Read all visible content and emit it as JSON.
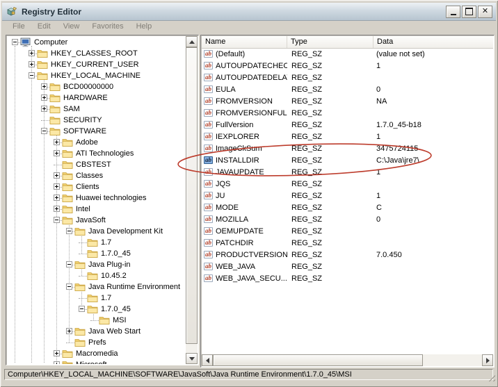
{
  "window": {
    "title": "Registry Editor",
    "app_icon": "regedit-icon",
    "controls": {
      "minimize": "minimize",
      "maximize": "maximize",
      "close": "close"
    }
  },
  "menu": {
    "items": [
      "File",
      "Edit",
      "View",
      "Favorites",
      "Help"
    ]
  },
  "tree": {
    "items": [
      {
        "label": "Computer",
        "level": 0,
        "toggle": "minus",
        "icon": "computer"
      },
      {
        "label": "HKEY_CLASSES_ROOT",
        "level": 1,
        "toggle": "plus",
        "icon": "folder"
      },
      {
        "label": "HKEY_CURRENT_USER",
        "level": 1,
        "toggle": "plus",
        "icon": "folder"
      },
      {
        "label": "HKEY_LOCAL_MACHINE",
        "level": 1,
        "toggle": "minus",
        "icon": "folder"
      },
      {
        "label": "BCD00000000",
        "level": 2,
        "toggle": "plus",
        "icon": "folder"
      },
      {
        "label": "HARDWARE",
        "level": 2,
        "toggle": "plus",
        "icon": "folder"
      },
      {
        "label": "SAM",
        "level": 2,
        "toggle": "plus",
        "icon": "folder"
      },
      {
        "label": "SECURITY",
        "level": 2,
        "toggle": "none",
        "icon": "folder"
      },
      {
        "label": "SOFTWARE",
        "level": 2,
        "toggle": "minus",
        "icon": "folder"
      },
      {
        "label": "Adobe",
        "level": 3,
        "toggle": "plus",
        "icon": "folder"
      },
      {
        "label": "ATI Technologies",
        "level": 3,
        "toggle": "plus",
        "icon": "folder"
      },
      {
        "label": "CBSTEST",
        "level": 3,
        "toggle": "none",
        "icon": "folder"
      },
      {
        "label": "Classes",
        "level": 3,
        "toggle": "plus",
        "icon": "folder"
      },
      {
        "label": "Clients",
        "level": 3,
        "toggle": "plus",
        "icon": "folder"
      },
      {
        "label": "Huawei technologies",
        "level": 3,
        "toggle": "plus",
        "icon": "folder"
      },
      {
        "label": "Intel",
        "level": 3,
        "toggle": "plus",
        "icon": "folder"
      },
      {
        "label": "JavaSoft",
        "level": 3,
        "toggle": "minus",
        "icon": "folder"
      },
      {
        "label": "Java Development Kit",
        "level": 4,
        "toggle": "minus",
        "icon": "folder"
      },
      {
        "label": "1.7",
        "level": 5,
        "toggle": "none",
        "icon": "folder"
      },
      {
        "label": "1.7.0_45",
        "level": 5,
        "toggle": "none",
        "icon": "folder"
      },
      {
        "label": "Java Plug-in",
        "level": 4,
        "toggle": "minus",
        "icon": "folder"
      },
      {
        "label": "10.45.2",
        "level": 5,
        "toggle": "none",
        "icon": "folder"
      },
      {
        "label": "Java Runtime Environment",
        "level": 4,
        "toggle": "minus",
        "icon": "folder"
      },
      {
        "label": "1.7",
        "level": 5,
        "toggle": "none",
        "icon": "folder"
      },
      {
        "label": "1.7.0_45",
        "level": 5,
        "toggle": "minus",
        "icon": "folder"
      },
      {
        "label": "MSI",
        "level": 6,
        "toggle": "none",
        "icon": "folder"
      },
      {
        "label": "Java Web Start",
        "level": 4,
        "toggle": "plus",
        "icon": "folder"
      },
      {
        "label": "Prefs",
        "level": 4,
        "toggle": "none",
        "icon": "folder"
      },
      {
        "label": "Macromedia",
        "level": 3,
        "toggle": "plus",
        "icon": "folder"
      },
      {
        "label": "Microsoft",
        "level": 3,
        "toggle": "plus",
        "icon": "folder"
      }
    ]
  },
  "list": {
    "columns": [
      "Name",
      "Type",
      "Data"
    ],
    "rows": [
      {
        "name": "(Default)",
        "type": "REG_SZ",
        "data": "(value not set)",
        "selected": false
      },
      {
        "name": "AUTOUPDATECHECK",
        "type": "REG_SZ",
        "data": "1",
        "selected": false
      },
      {
        "name": "AUTOUPDATEDELAY",
        "type": "REG_SZ",
        "data": "",
        "selected": false
      },
      {
        "name": "EULA",
        "type": "REG_SZ",
        "data": "0",
        "selected": false
      },
      {
        "name": "FROMVERSION",
        "type": "REG_SZ",
        "data": "NA",
        "selected": false
      },
      {
        "name": "FROMVERSIONFULL",
        "type": "REG_SZ",
        "data": "",
        "selected": false
      },
      {
        "name": "FullVersion",
        "type": "REG_SZ",
        "data": "1.7.0_45-b18",
        "selected": false
      },
      {
        "name": "IEXPLORER",
        "type": "REG_SZ",
        "data": "1",
        "selected": false
      },
      {
        "name": "ImageCkSum",
        "type": "REG_SZ",
        "data": "3475724115",
        "selected": false
      },
      {
        "name": "INSTALLDIR",
        "type": "REG_SZ",
        "data": "C:\\Java\\jre7\\",
        "selected": true
      },
      {
        "name": "JAVAUPDATE",
        "type": "REG_SZ",
        "data": "1",
        "selected": false
      },
      {
        "name": "JQS",
        "type": "REG_SZ",
        "data": "",
        "selected": false
      },
      {
        "name": "JU",
        "type": "REG_SZ",
        "data": "1",
        "selected": false
      },
      {
        "name": "MODE",
        "type": "REG_SZ",
        "data": "C",
        "selected": false
      },
      {
        "name": "MOZILLA",
        "type": "REG_SZ",
        "data": "0",
        "selected": false
      },
      {
        "name": "OEMUPDATE",
        "type": "REG_SZ",
        "data": "",
        "selected": false
      },
      {
        "name": "PATCHDIR",
        "type": "REG_SZ",
        "data": "",
        "selected": false
      },
      {
        "name": "PRODUCTVERSION",
        "type": "REG_SZ",
        "data": "7.0.450",
        "selected": false
      },
      {
        "name": "WEB_JAVA",
        "type": "REG_SZ",
        "data": "",
        "selected": false
      },
      {
        "name": "WEB_JAVA_SECU...",
        "type": "REG_SZ",
        "data": "",
        "selected": false
      }
    ]
  },
  "status": {
    "path": "Computer\\HKEY_LOCAL_MACHINE\\SOFTWARE\\JavaSoft\\Java Runtime Environment\\1.7.0_45\\MSI"
  },
  "annotation": {
    "type": "hand-drawn-ellipse",
    "circled_value": "INSTALLDIR",
    "color": "#b93221"
  }
}
